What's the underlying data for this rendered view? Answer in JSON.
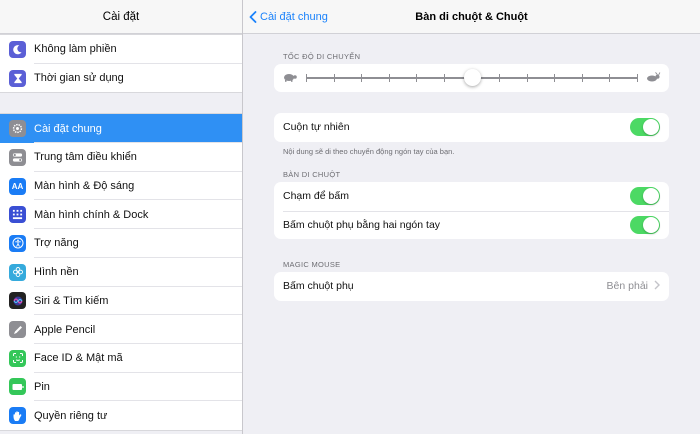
{
  "sidebar": {
    "title": "Cài đặt",
    "group1": [
      {
        "label": "Không làm phiền",
        "icon": "moon-icon",
        "color": "#5b5fd6"
      },
      {
        "label": "Thời gian sử dụng",
        "icon": "hourglass-icon",
        "color": "#5b5fd6"
      }
    ],
    "group2": [
      {
        "label": "Cài đặt chung",
        "icon": "gear-icon",
        "color": "#8e8e93",
        "selected": true
      },
      {
        "label": "Trung tâm điều khiển",
        "icon": "switches-icon",
        "color": "#8e8e93"
      },
      {
        "label": "Màn hình & Độ sáng",
        "icon": "text-size-icon",
        "color": "#1a7cf5"
      },
      {
        "label": "Màn hình chính & Dock",
        "icon": "grid-icon",
        "color": "#3a4fd4"
      },
      {
        "label": "Trợ năng",
        "icon": "accessibility-icon",
        "color": "#1a7cf5"
      },
      {
        "label": "Hình nền",
        "icon": "flower-icon",
        "color": "#35aadc"
      },
      {
        "label": "Siri & Tìm kiếm",
        "icon": "siri-icon",
        "color": "#222222"
      },
      {
        "label": "Apple Pencil",
        "icon": "pencil-icon",
        "color": "#8e8e93"
      },
      {
        "label": "Face ID & Mật mã",
        "icon": "face-id-icon",
        "color": "#34c759"
      },
      {
        "label": "Pin",
        "icon": "battery-icon",
        "color": "#34c759"
      },
      {
        "label": "Quyền riêng tư",
        "icon": "hand-icon",
        "color": "#1a7cf5"
      }
    ]
  },
  "header": {
    "back_label": "Cài đặt chung",
    "title": "Bàn di chuột & Chuột"
  },
  "speed": {
    "label": "TỐC ĐỘ DI CHUYỂN",
    "value": 0.5
  },
  "natural_scroll": {
    "label": "Cuộn tự nhiên",
    "on": true,
    "footnote": "Nội dung sẽ di theo chuyển động ngón tay của bạn."
  },
  "trackpad": {
    "section_label": "BÀN DI CHUỘT",
    "tap_to_click": {
      "label": "Chạm để bấm",
      "on": true
    },
    "two_finger": {
      "label": "Bấm chuột phụ bằng hai ngón tay",
      "on": true
    }
  },
  "magic_mouse": {
    "section_label": "MAGIC MOUSE",
    "secondary_click": {
      "label": "Bấm chuột phụ",
      "value": "Bên phải"
    }
  },
  "colors": {
    "accent": "#1a82fb",
    "toggle_on": "#4cd964",
    "selected": "#2f90f4"
  }
}
